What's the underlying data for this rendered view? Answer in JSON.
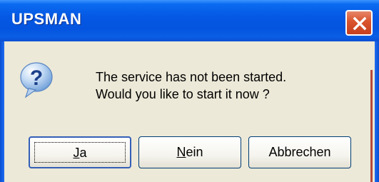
{
  "window": {
    "title": "UPSMAN",
    "close_icon": "close-icon"
  },
  "message": {
    "icon": "question-icon",
    "line1": "The service has not been started.",
    "line2": "Would you like to start it now ?"
  },
  "buttons": {
    "yes": {
      "mnemonic": "J",
      "rest": "a"
    },
    "no": {
      "mnemonic": "N",
      "rest": "ein"
    },
    "cancel": {
      "label": "Abbrechen"
    }
  },
  "colors": {
    "titlebar": "#0558e4",
    "close_button": "#d9532c",
    "dialog_background": "#ece9d8"
  }
}
